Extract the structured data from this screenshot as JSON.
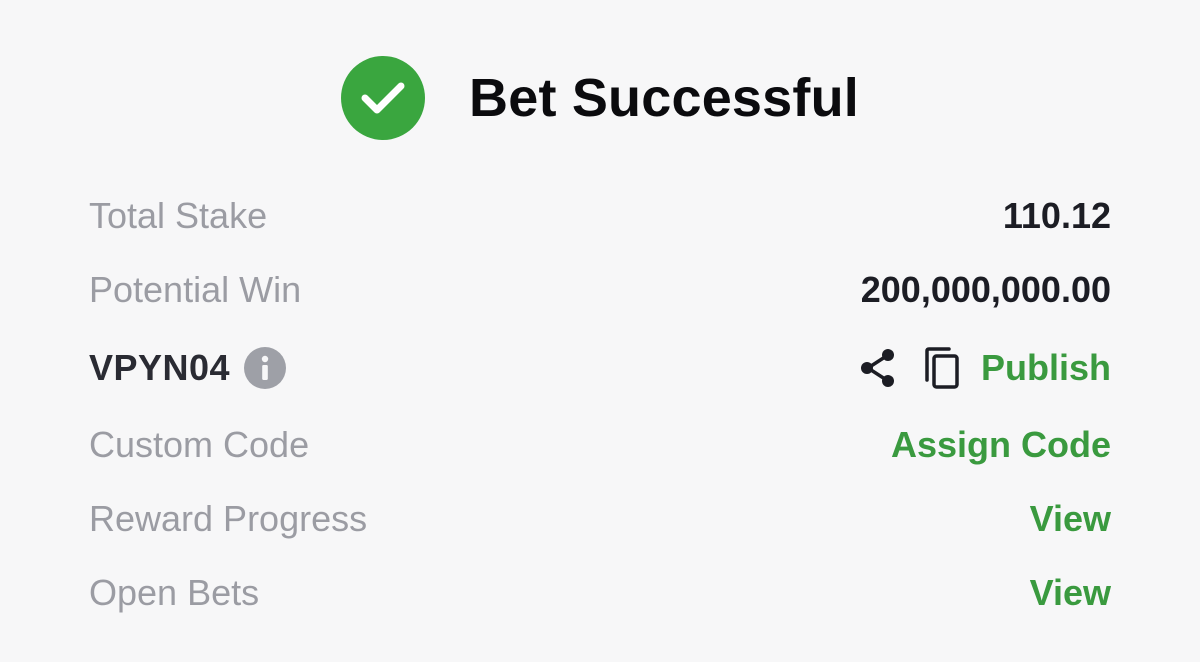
{
  "header": {
    "title": "Bet Successful",
    "status_icon": "check-circle-icon",
    "accent_color": "#3aa63f"
  },
  "summary": {
    "total_stake_label": "Total Stake",
    "total_stake_value": "110.12",
    "potential_win_label": "Potential Win",
    "potential_win_value": "200,000,000.00"
  },
  "booking": {
    "code": "VPYN04",
    "info_icon": "info-icon",
    "share_icon": "share-icon",
    "copy_icon": "copy-icon",
    "publish_label": "Publish"
  },
  "actions": {
    "custom_code_label": "Custom Code",
    "custom_code_action": "Assign Code",
    "reward_progress_label": "Reward Progress",
    "reward_progress_action": "View",
    "open_bets_label": "Open Bets",
    "open_bets_action": "View"
  }
}
